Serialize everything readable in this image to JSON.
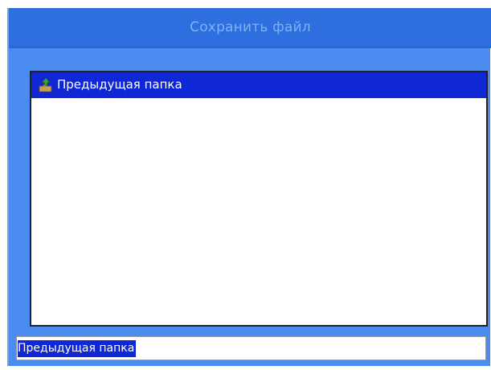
{
  "dialog": {
    "title": "Сохранить файл"
  },
  "file_list": {
    "items": [
      {
        "icon": "up-folder-icon",
        "label": "Предыдущая папка",
        "selected": true
      }
    ]
  },
  "filename_field": {
    "value": "Предыдущая папка"
  },
  "colors": {
    "dialog_background": "#4a8cf0",
    "title_bar": "#2e6fe0",
    "title_text": "#7fb0f8",
    "selection": "#0f27d4",
    "list_background": "#ffffff"
  }
}
